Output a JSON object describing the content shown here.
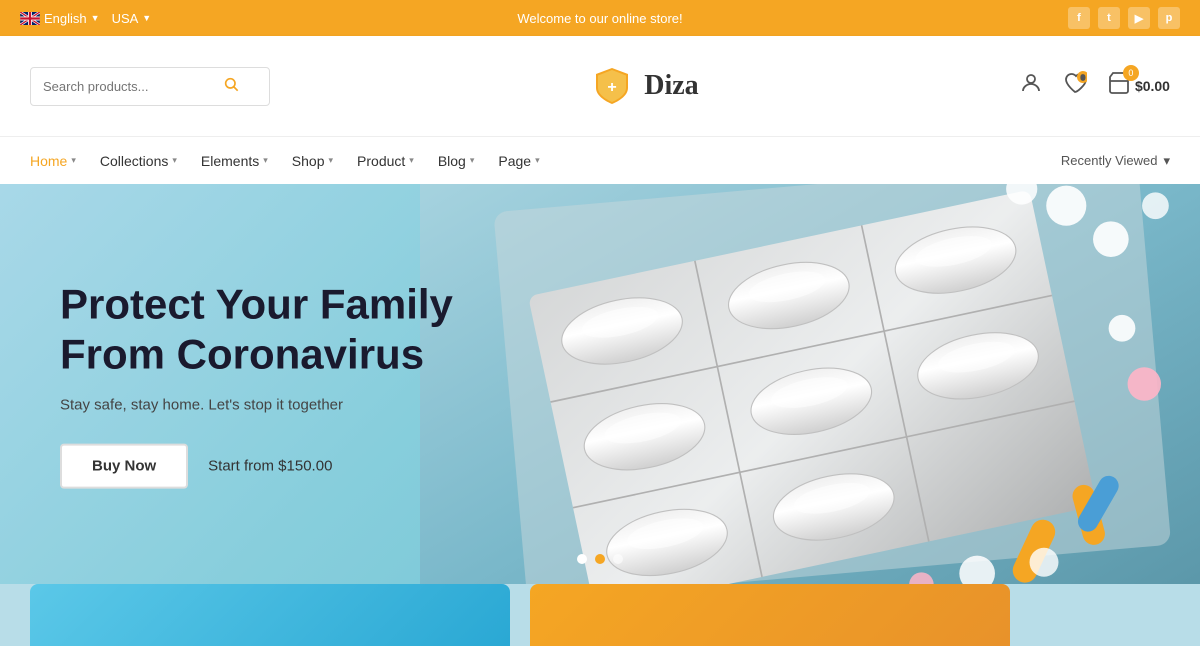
{
  "topbar": {
    "lang": "English",
    "country": "USA",
    "welcome": "Welcome to our online store!",
    "socials": [
      "f",
      "t",
      "y",
      "p"
    ]
  },
  "header": {
    "logo_text": "Diza",
    "search_placeholder": "Search products...",
    "cart_price": "$0.00",
    "cart_badge": "0"
  },
  "nav": {
    "items": [
      {
        "label": "Home",
        "active": true,
        "has_dropdown": true
      },
      {
        "label": "Collections",
        "active": false,
        "has_dropdown": true
      },
      {
        "label": "Elements",
        "active": false,
        "has_dropdown": true
      },
      {
        "label": "Shop",
        "active": false,
        "has_dropdown": true
      },
      {
        "label": "Product",
        "active": false,
        "has_dropdown": true
      },
      {
        "label": "Blog",
        "active": false,
        "has_dropdown": true
      },
      {
        "label": "Page",
        "active": false,
        "has_dropdown": true
      }
    ],
    "recently_viewed": "Recently Viewed"
  },
  "hero": {
    "title_line1": "Protect Your Family",
    "title_line2": "From Coronavirus",
    "subtitle": "Stay safe, stay home. Let's stop it together",
    "buy_now": "Buy Now",
    "price_text": "Start from $150.00",
    "dots": [
      {
        "active": true
      },
      {
        "active": false,
        "orange": true
      },
      {
        "active": false
      }
    ]
  }
}
